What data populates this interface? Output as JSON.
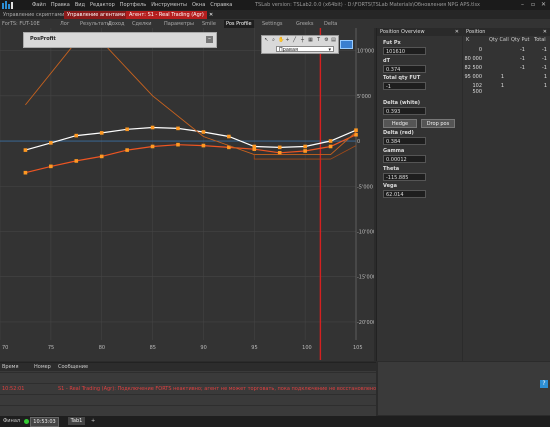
{
  "titlebar": {
    "menu": [
      "Файл",
      "Правка",
      "Вид",
      "Редактор",
      "Портфель",
      "Инструменты",
      "Окна",
      "Справка"
    ],
    "title": "TSLab version: TSLab2.0.0 (x64bit) · D:\\FORTS\\TSLab Materials\\Обновления NPG APS.tlsx"
  },
  "workspace_tabs": [
    "Управление скриптами",
    "Управление агентами",
    "Агент: S1 - Real Trading (Agr)",
    "Параметры",
    "Delta"
  ],
  "module_tabs": [
    "ForTS: FUT-10E",
    "Лог",
    "Результаты",
    "Доход",
    "Сделки",
    "Параметры",
    "Smile",
    "Pos Profile",
    "Settings",
    "Greeks",
    "Delta"
  ],
  "active_module_tab": "Pos Profile",
  "chart": {
    "panel_title": "PosProfit",
    "series_select": "Правая",
    "x_ticks": [
      "70",
      "75",
      "80",
      "85",
      "90",
      "95",
      "100",
      "105"
    ],
    "y_ticks": [
      "10'000",
      "5'000",
      "0",
      "-5'000",
      "-10'000",
      "-15'000",
      "-20'000"
    ]
  },
  "chart_data": {
    "type": "line",
    "x_ticks": [
      70,
      75,
      80,
      85,
      90,
      95,
      100,
      105
    ],
    "y_ticks": [
      10000,
      5000,
      0,
      -5000,
      -10000,
      -15000,
      -20000
    ],
    "vertical_marker_x": 101.5,
    "series": [
      {
        "color": "#ffffff",
        "marker": "#ff9922",
        "points": [
          [
            72.5,
            -1000
          ],
          [
            75,
            -200
          ],
          [
            77.5,
            600
          ],
          [
            80,
            900
          ],
          [
            82.5,
            1300
          ],
          [
            85,
            1500
          ],
          [
            87.5,
            1400
          ],
          [
            90,
            1000
          ],
          [
            92.5,
            500
          ],
          [
            95,
            -600
          ],
          [
            97.5,
            -700
          ],
          [
            100,
            -600
          ],
          [
            102.5,
            0
          ],
          [
            105,
            1200
          ]
        ]
      },
      {
        "color": "#ee5522",
        "marker": "#ff9922",
        "points": [
          [
            72.5,
            -3500
          ],
          [
            75,
            -2800
          ],
          [
            77.5,
            -2200
          ],
          [
            80,
            -1700
          ],
          [
            82.5,
            -1000
          ],
          [
            85,
            -600
          ],
          [
            87.5,
            -400
          ],
          [
            90,
            -500
          ],
          [
            92.5,
            -700
          ],
          [
            95,
            -900
          ],
          [
            97.5,
            -1300
          ],
          [
            100,
            -1100
          ],
          [
            102.5,
            -600
          ],
          [
            105,
            700
          ]
        ]
      },
      {
        "color": "#c8621e",
        "points": [
          [
            72.5,
            4000
          ],
          [
            77.5,
            11000
          ],
          [
            80,
            11000
          ],
          [
            85,
            5000
          ],
          [
            90,
            500
          ],
          [
            95,
            -1500
          ],
          [
            100,
            -1500
          ],
          [
            102.5,
            -1500
          ],
          [
            105,
            1000
          ]
        ]
      },
      {
        "color": "#a04a18",
        "points": [
          [
            95,
            -1500
          ],
          [
            95,
            -2000
          ],
          [
            102.5,
            -2000
          ],
          [
            105,
            -500
          ]
        ]
      }
    ]
  },
  "overview": {
    "title": "Position Overview",
    "fut_px_label": "Fut Px",
    "fut_px": "101610",
    "dT_label": "dT",
    "dT": "0.374",
    "total_qty_label": "Total qty FUT",
    "total_qty": "-1",
    "delta_white_label": "Delta (white)",
    "delta_white": "0.393",
    "hedge_btn": "Hedge",
    "drop_pos_btn": "Drop pos",
    "delta_red_label": "Delta (red)",
    "delta_red": "0.384",
    "gamma_label": "Gamma",
    "gamma": "0.00012",
    "theta_label": "Theta",
    "theta": "-115.885",
    "vega_label": "Vega",
    "vega": "62.014"
  },
  "position": {
    "title": "Position",
    "headers": [
      "K",
      "Qty Call",
      "Qty Put",
      "Total"
    ],
    "rows": [
      {
        "k": "0",
        "call": "",
        "put": "-1",
        "total": "-1"
      },
      {
        "k": "80 000",
        "call": "",
        "put": "-1",
        "total": "-1"
      },
      {
        "k": "82 500",
        "call": "",
        "put": "-1",
        "total": "-1"
      },
      {
        "k": "95 000",
        "call": "1",
        "put": "",
        "total": "1"
      },
      {
        "k": "102 500",
        "call": "1",
        "put": "",
        "total": "1"
      }
    ]
  },
  "log": {
    "headers": [
      "Время",
      "Номер",
      "Сообщение"
    ],
    "rows": [
      {
        "time": "",
        "msg": "",
        "color": "#e05050"
      },
      {
        "time": "10:52:01",
        "msg": "S1 - Real Trading (Agr): Подключение FORTS неактивно; агент не может торговать, пока подключение не восстановлено",
        "color": "#e04040"
      },
      {
        "time": "",
        "msg": "",
        "color": "#e05050"
      },
      {
        "time": "",
        "msg": "",
        "color": "#e05050"
      }
    ]
  },
  "status": {
    "left": "Финал",
    "clock": "10:53:03",
    "workspace": "Tab1",
    "add": "+"
  }
}
